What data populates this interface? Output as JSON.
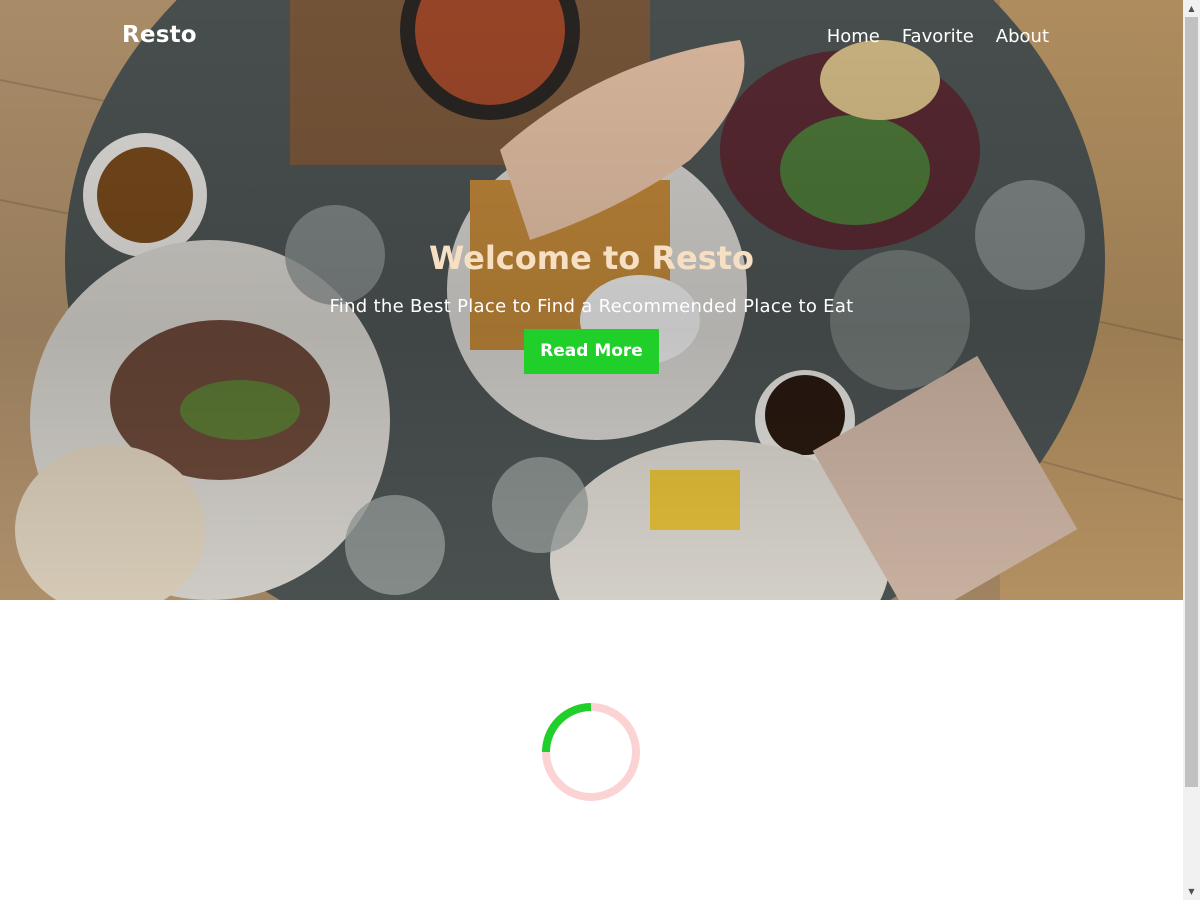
{
  "navbar": {
    "brand": "Resto",
    "links": [
      {
        "label": "Home"
      },
      {
        "label": "Favorite"
      },
      {
        "label": "About"
      }
    ]
  },
  "hero": {
    "title": "Welcome to Resto",
    "subtitle": "Find the Best Place to Find a Recommended Place to Eat",
    "cta_label": "Read More",
    "background": "overhead photo of a restaurant table with plates, waffles, coffee cups and glasses"
  },
  "loader": {
    "accent_color": "#21cf2b",
    "track_color": "#fbd3d3"
  },
  "colors": {
    "title": "#f7dfc3",
    "button": "#21cf2b",
    "nav_text": "#ffffff"
  }
}
